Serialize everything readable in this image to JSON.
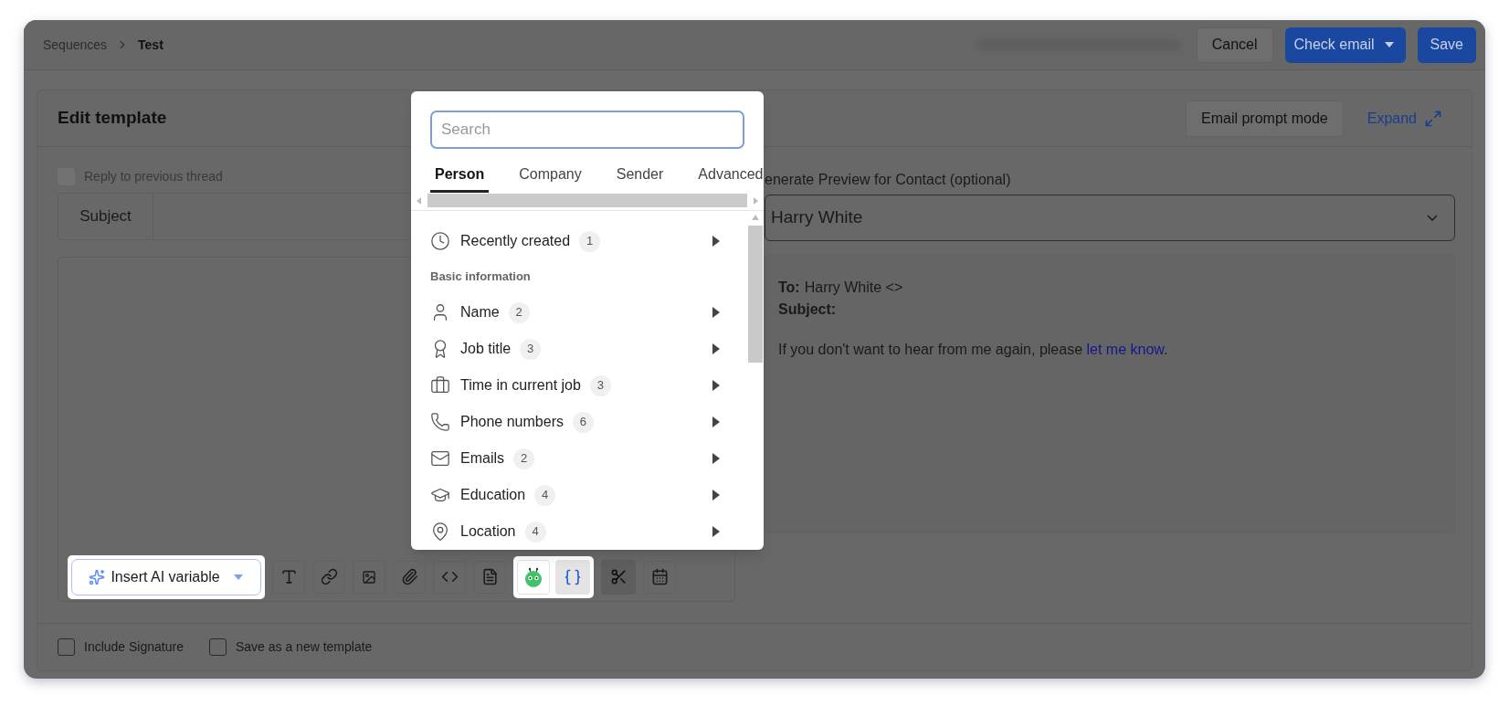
{
  "breadcrumb": {
    "parent": "Sequences",
    "current": "Test"
  },
  "header_buttons": {
    "cancel": "Cancel",
    "check_email": "Check email",
    "save": "Save"
  },
  "editor": {
    "title": "Edit template",
    "prompt_mode_button": "Email prompt mode",
    "expand_link": "Expand",
    "reply_to_previous": {
      "label": "Reply to previous thread",
      "checked": false,
      "disabled": true
    },
    "subject_label": "Subject",
    "insert_ai_variable": "Insert AI variable"
  },
  "footer_options": [
    {
      "label": "Include Signature",
      "checked": false
    },
    {
      "label": "Save as a new template",
      "checked": false
    }
  ],
  "preview": {
    "label": "enerate Preview for Contact (optional)",
    "contact": "Harry White",
    "to_label": "To:",
    "to_value": "Harry White <>",
    "subject_label": "Subject:",
    "body": "If you don't want to hear from me again, please ",
    "link": "let me know",
    "body_end": "."
  },
  "variable_menu": {
    "search": {
      "placeholder": "Search"
    },
    "tabs": [
      {
        "label": "Person",
        "selected": true
      },
      {
        "label": "Company",
        "selected": false
      },
      {
        "label": "Sender",
        "selected": false
      },
      {
        "label": "Advanced",
        "selected": false
      }
    ],
    "items": [
      {
        "kind": "item",
        "label": "Recently created",
        "count": "1"
      },
      {
        "kind": "heading",
        "label": "Basic information"
      },
      {
        "kind": "item",
        "label": "Name",
        "count": "2"
      },
      {
        "kind": "item",
        "label": "Job title",
        "count": "3"
      },
      {
        "kind": "item",
        "label": "Time in current job",
        "count": "3"
      },
      {
        "kind": "item",
        "label": "Phone numbers",
        "count": "6"
      },
      {
        "kind": "item",
        "label": "Emails",
        "count": "2"
      },
      {
        "kind": "item",
        "label": "Education",
        "count": "4"
      },
      {
        "kind": "item",
        "label": "Location",
        "count": "4"
      }
    ]
  }
}
